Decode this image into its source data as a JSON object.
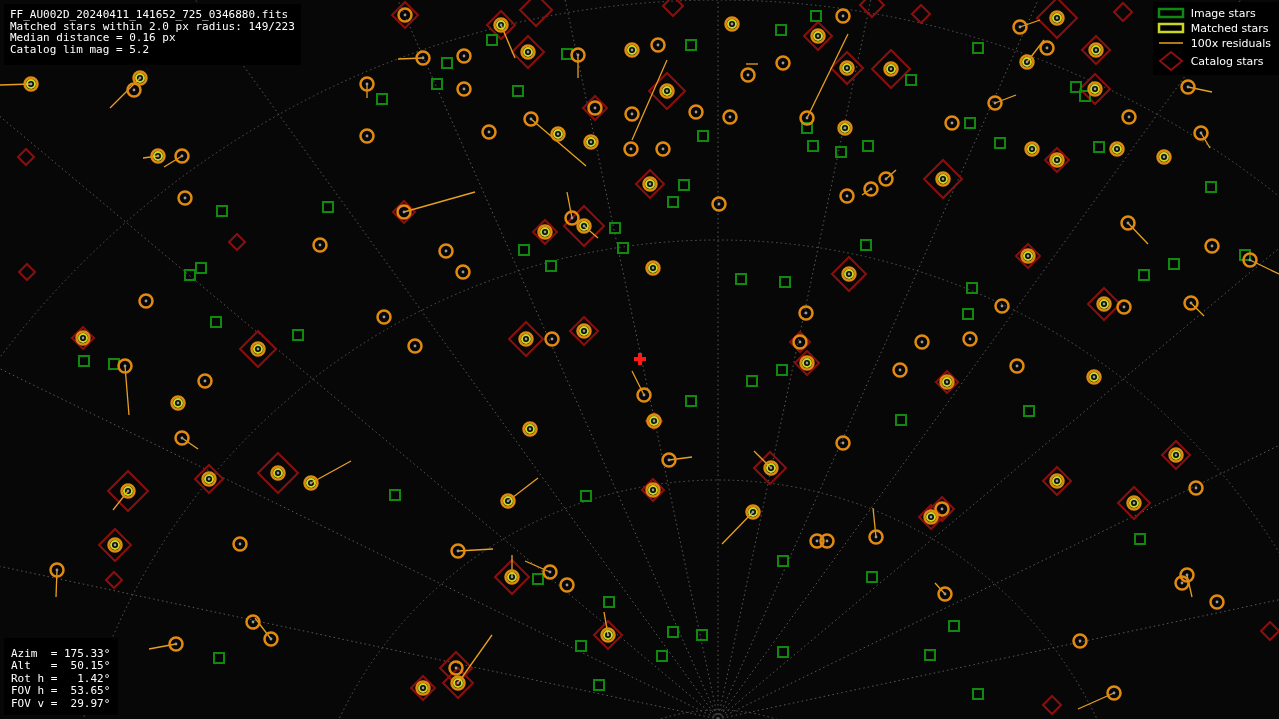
{
  "file_info": {
    "lines": [
      "FF_AU002D_20240411_141652_725_0346880.fits",
      "Matched stars within 2.0 px radius: 149/223",
      "Median distance = 0.16 px",
      "Catalog lim mag = 5.2"
    ]
  },
  "legend": [
    {
      "kind": "image",
      "label": "Image stars"
    },
    {
      "kind": "matched",
      "label": "Matched stars"
    },
    {
      "kind": "residual",
      "label": "100x residuals"
    },
    {
      "kind": "catalog",
      "label": "Catalog stars"
    }
  ],
  "pointing": {
    "lines": [
      "Azim  = 175.33°",
      "Alt   =  50.15°",
      "Rot h =   1.42°",
      "FOV h =  53.65°",
      "FOV v =  29.97°"
    ]
  }
}
